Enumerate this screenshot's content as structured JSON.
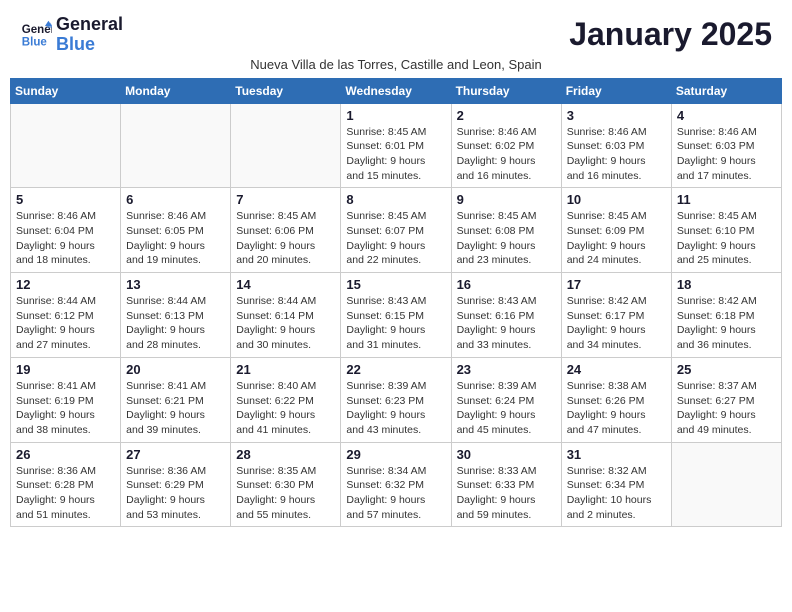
{
  "header": {
    "logo_line1": "General",
    "logo_line2": "Blue",
    "month_title": "January 2025",
    "subtitle": "Nueva Villa de las Torres, Castille and Leon, Spain"
  },
  "weekdays": [
    "Sunday",
    "Monday",
    "Tuesday",
    "Wednesday",
    "Thursday",
    "Friday",
    "Saturday"
  ],
  "weeks": [
    {
      "days": [
        {
          "number": "",
          "info": ""
        },
        {
          "number": "",
          "info": ""
        },
        {
          "number": "",
          "info": ""
        },
        {
          "number": "1",
          "info": "Sunrise: 8:45 AM\nSunset: 6:01 PM\nDaylight: 9 hours and 15 minutes."
        },
        {
          "number": "2",
          "info": "Sunrise: 8:46 AM\nSunset: 6:02 PM\nDaylight: 9 hours and 16 minutes."
        },
        {
          "number": "3",
          "info": "Sunrise: 8:46 AM\nSunset: 6:03 PM\nDaylight: 9 hours and 16 minutes."
        },
        {
          "number": "4",
          "info": "Sunrise: 8:46 AM\nSunset: 6:03 PM\nDaylight: 9 hours and 17 minutes."
        }
      ]
    },
    {
      "days": [
        {
          "number": "5",
          "info": "Sunrise: 8:46 AM\nSunset: 6:04 PM\nDaylight: 9 hours and 18 minutes."
        },
        {
          "number": "6",
          "info": "Sunrise: 8:46 AM\nSunset: 6:05 PM\nDaylight: 9 hours and 19 minutes."
        },
        {
          "number": "7",
          "info": "Sunrise: 8:45 AM\nSunset: 6:06 PM\nDaylight: 9 hours and 20 minutes."
        },
        {
          "number": "8",
          "info": "Sunrise: 8:45 AM\nSunset: 6:07 PM\nDaylight: 9 hours and 22 minutes."
        },
        {
          "number": "9",
          "info": "Sunrise: 8:45 AM\nSunset: 6:08 PM\nDaylight: 9 hours and 23 minutes."
        },
        {
          "number": "10",
          "info": "Sunrise: 8:45 AM\nSunset: 6:09 PM\nDaylight: 9 hours and 24 minutes."
        },
        {
          "number": "11",
          "info": "Sunrise: 8:45 AM\nSunset: 6:10 PM\nDaylight: 9 hours and 25 minutes."
        }
      ]
    },
    {
      "days": [
        {
          "number": "12",
          "info": "Sunrise: 8:44 AM\nSunset: 6:12 PM\nDaylight: 9 hours and 27 minutes."
        },
        {
          "number": "13",
          "info": "Sunrise: 8:44 AM\nSunset: 6:13 PM\nDaylight: 9 hours and 28 minutes."
        },
        {
          "number": "14",
          "info": "Sunrise: 8:44 AM\nSunset: 6:14 PM\nDaylight: 9 hours and 30 minutes."
        },
        {
          "number": "15",
          "info": "Sunrise: 8:43 AM\nSunset: 6:15 PM\nDaylight: 9 hours and 31 minutes."
        },
        {
          "number": "16",
          "info": "Sunrise: 8:43 AM\nSunset: 6:16 PM\nDaylight: 9 hours and 33 minutes."
        },
        {
          "number": "17",
          "info": "Sunrise: 8:42 AM\nSunset: 6:17 PM\nDaylight: 9 hours and 34 minutes."
        },
        {
          "number": "18",
          "info": "Sunrise: 8:42 AM\nSunset: 6:18 PM\nDaylight: 9 hours and 36 minutes."
        }
      ]
    },
    {
      "days": [
        {
          "number": "19",
          "info": "Sunrise: 8:41 AM\nSunset: 6:19 PM\nDaylight: 9 hours and 38 minutes."
        },
        {
          "number": "20",
          "info": "Sunrise: 8:41 AM\nSunset: 6:21 PM\nDaylight: 9 hours and 39 minutes."
        },
        {
          "number": "21",
          "info": "Sunrise: 8:40 AM\nSunset: 6:22 PM\nDaylight: 9 hours and 41 minutes."
        },
        {
          "number": "22",
          "info": "Sunrise: 8:39 AM\nSunset: 6:23 PM\nDaylight: 9 hours and 43 minutes."
        },
        {
          "number": "23",
          "info": "Sunrise: 8:39 AM\nSunset: 6:24 PM\nDaylight: 9 hours and 45 minutes."
        },
        {
          "number": "24",
          "info": "Sunrise: 8:38 AM\nSunset: 6:26 PM\nDaylight: 9 hours and 47 minutes."
        },
        {
          "number": "25",
          "info": "Sunrise: 8:37 AM\nSunset: 6:27 PM\nDaylight: 9 hours and 49 minutes."
        }
      ]
    },
    {
      "days": [
        {
          "number": "26",
          "info": "Sunrise: 8:36 AM\nSunset: 6:28 PM\nDaylight: 9 hours and 51 minutes."
        },
        {
          "number": "27",
          "info": "Sunrise: 8:36 AM\nSunset: 6:29 PM\nDaylight: 9 hours and 53 minutes."
        },
        {
          "number": "28",
          "info": "Sunrise: 8:35 AM\nSunset: 6:30 PM\nDaylight: 9 hours and 55 minutes."
        },
        {
          "number": "29",
          "info": "Sunrise: 8:34 AM\nSunset: 6:32 PM\nDaylight: 9 hours and 57 minutes."
        },
        {
          "number": "30",
          "info": "Sunrise: 8:33 AM\nSunset: 6:33 PM\nDaylight: 9 hours and 59 minutes."
        },
        {
          "number": "31",
          "info": "Sunrise: 8:32 AM\nSunset: 6:34 PM\nDaylight: 10 hours and 2 minutes."
        },
        {
          "number": "",
          "info": ""
        }
      ]
    }
  ]
}
